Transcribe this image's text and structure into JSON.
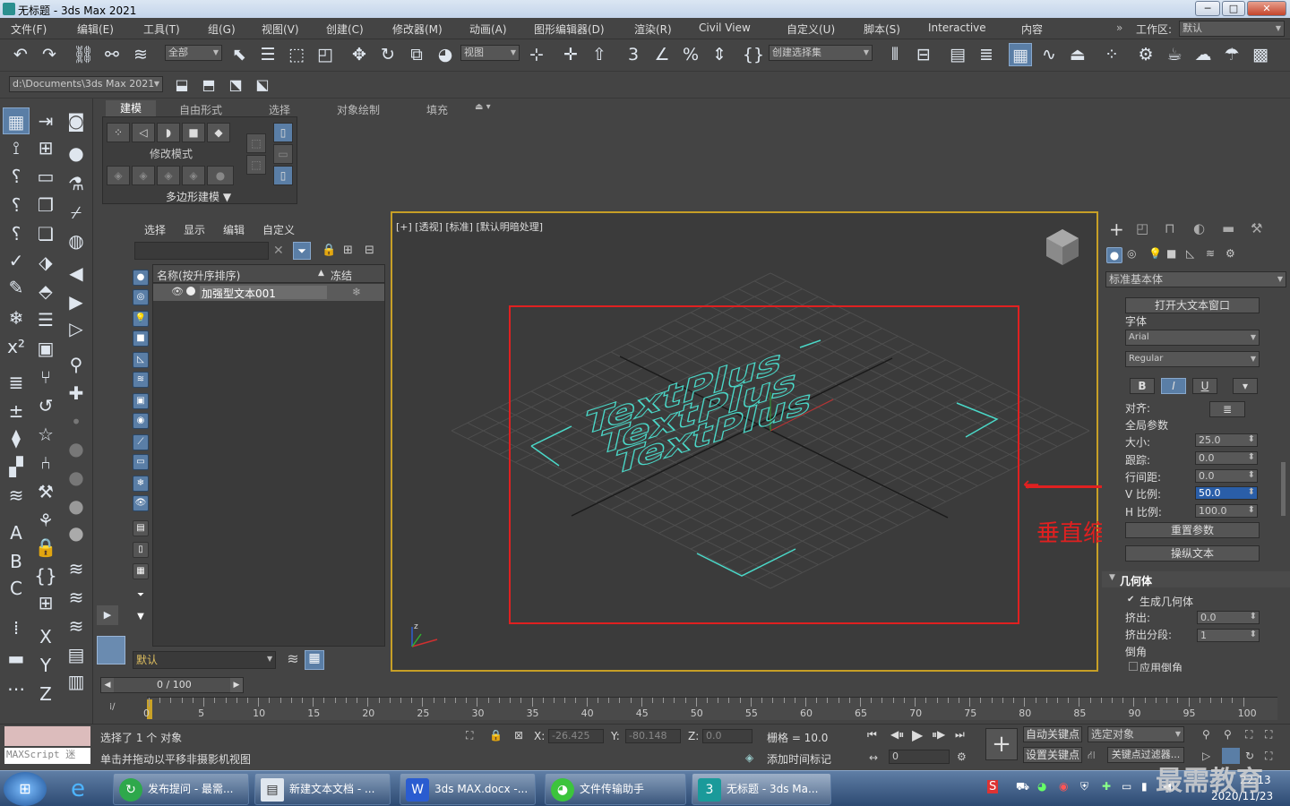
{
  "window": {
    "title": "无标题 - 3ds Max 2021",
    "min": "─",
    "max": "□",
    "close": "✕"
  },
  "menu": [
    "文件(F)",
    "编辑(E)",
    "工具(T)",
    "组(G)",
    "视图(V)",
    "创建(C)",
    "修改器(M)",
    "动画(A)",
    "图形编辑器(D)",
    "渲染(R)",
    "Civil View",
    "自定义(U)",
    "脚本(S)",
    "Interactive",
    "内容"
  ],
  "workspace": {
    "label": "工作区:",
    "value": "默认",
    "expand": "»"
  },
  "toolbar": {
    "filter_all": "全部",
    "ref_coord": "视图",
    "selection_set": "创建选择集"
  },
  "path": {
    "value": "d:\\Documents\\3ds Max 2021"
  },
  "ribbon": {
    "tabs": [
      "建模",
      "自由形式",
      "选择",
      "对象绘制",
      "填充"
    ],
    "modify_mode": "修改模式",
    "poly_modeling": "多边形建模 ▼"
  },
  "scene": {
    "tabs": [
      "选择",
      "显示",
      "编辑",
      "自定义"
    ],
    "col_name": "名称(按升序排序)",
    "sort_arrow": "▲",
    "col_freeze": "冻结",
    "item": "加强型文本001",
    "layer": "默认",
    "eye": "👁"
  },
  "viewport": {
    "label": "[+] [透视] [标准] [默认明暗处理]",
    "annotation": "垂直缩放",
    "arrow": "←",
    "text": "TextPlus",
    "gizmo": "z"
  },
  "cmd": {
    "category": "标准基本体",
    "open_big_text": "打开大文本窗口",
    "font_label": "字体",
    "font": "Arial",
    "style": "Regular",
    "bold": "B",
    "italic": "I",
    "underline": "U",
    "align_label": "对齐:",
    "global_params": "全局参数",
    "size_label": "大小:",
    "size": "25.0",
    "tracking_label": "跟踪:",
    "tracking": "0.0",
    "leading_label": "行间距:",
    "leading": "0.0",
    "vscale_label": "V 比例:",
    "vscale": "50.0",
    "hscale_label": "H 比例:",
    "hscale": "100.0",
    "reset_params": "重置参数",
    "manip_text": "操纵文本",
    "geometry": "几何体",
    "gen_geometry": "生成几何体",
    "extrude_label": "挤出:",
    "extrude": "0.0",
    "extrude_seg_label": "挤出分段:",
    "extrude_seg": "1",
    "bevel": "倒角",
    "apply_bevel": "应用倒角"
  },
  "timeline": {
    "frame": "0 / 100",
    "ticks": [
      "0",
      "5",
      "10",
      "15",
      "20",
      "25",
      "30",
      "35",
      "40",
      "45",
      "50",
      "55",
      "60",
      "65",
      "70",
      "75",
      "80",
      "85",
      "90",
      "95",
      "100"
    ]
  },
  "status": {
    "maxscript": "MAXScript 迷",
    "selected": "选择了 1 个 对象",
    "hint": "单击并拖动以平移非摄影机视图",
    "x_label": "X:",
    "x": "-26.425",
    "y_label": "Y:",
    "y": "-80.148",
    "z_label": "Z:",
    "z": "0.0",
    "grid": "栅格 = 10.0",
    "add_time_tag": "添加时间标记",
    "auto_key": "自动关键点",
    "selected_obj": "选定对象",
    "set_key": "设置关键点",
    "key_filter": "关键点过滤器...",
    "frame": "0"
  },
  "taskbar": {
    "items": [
      "发布提问 - 最需...",
      "新建文本文档 - ...",
      "3ds MAX.docx -...",
      "文件传输助手",
      "无标题 - 3ds Ma..."
    ],
    "time": "22:13",
    "date": "2020/11/23",
    "watermark": "最需教育"
  }
}
